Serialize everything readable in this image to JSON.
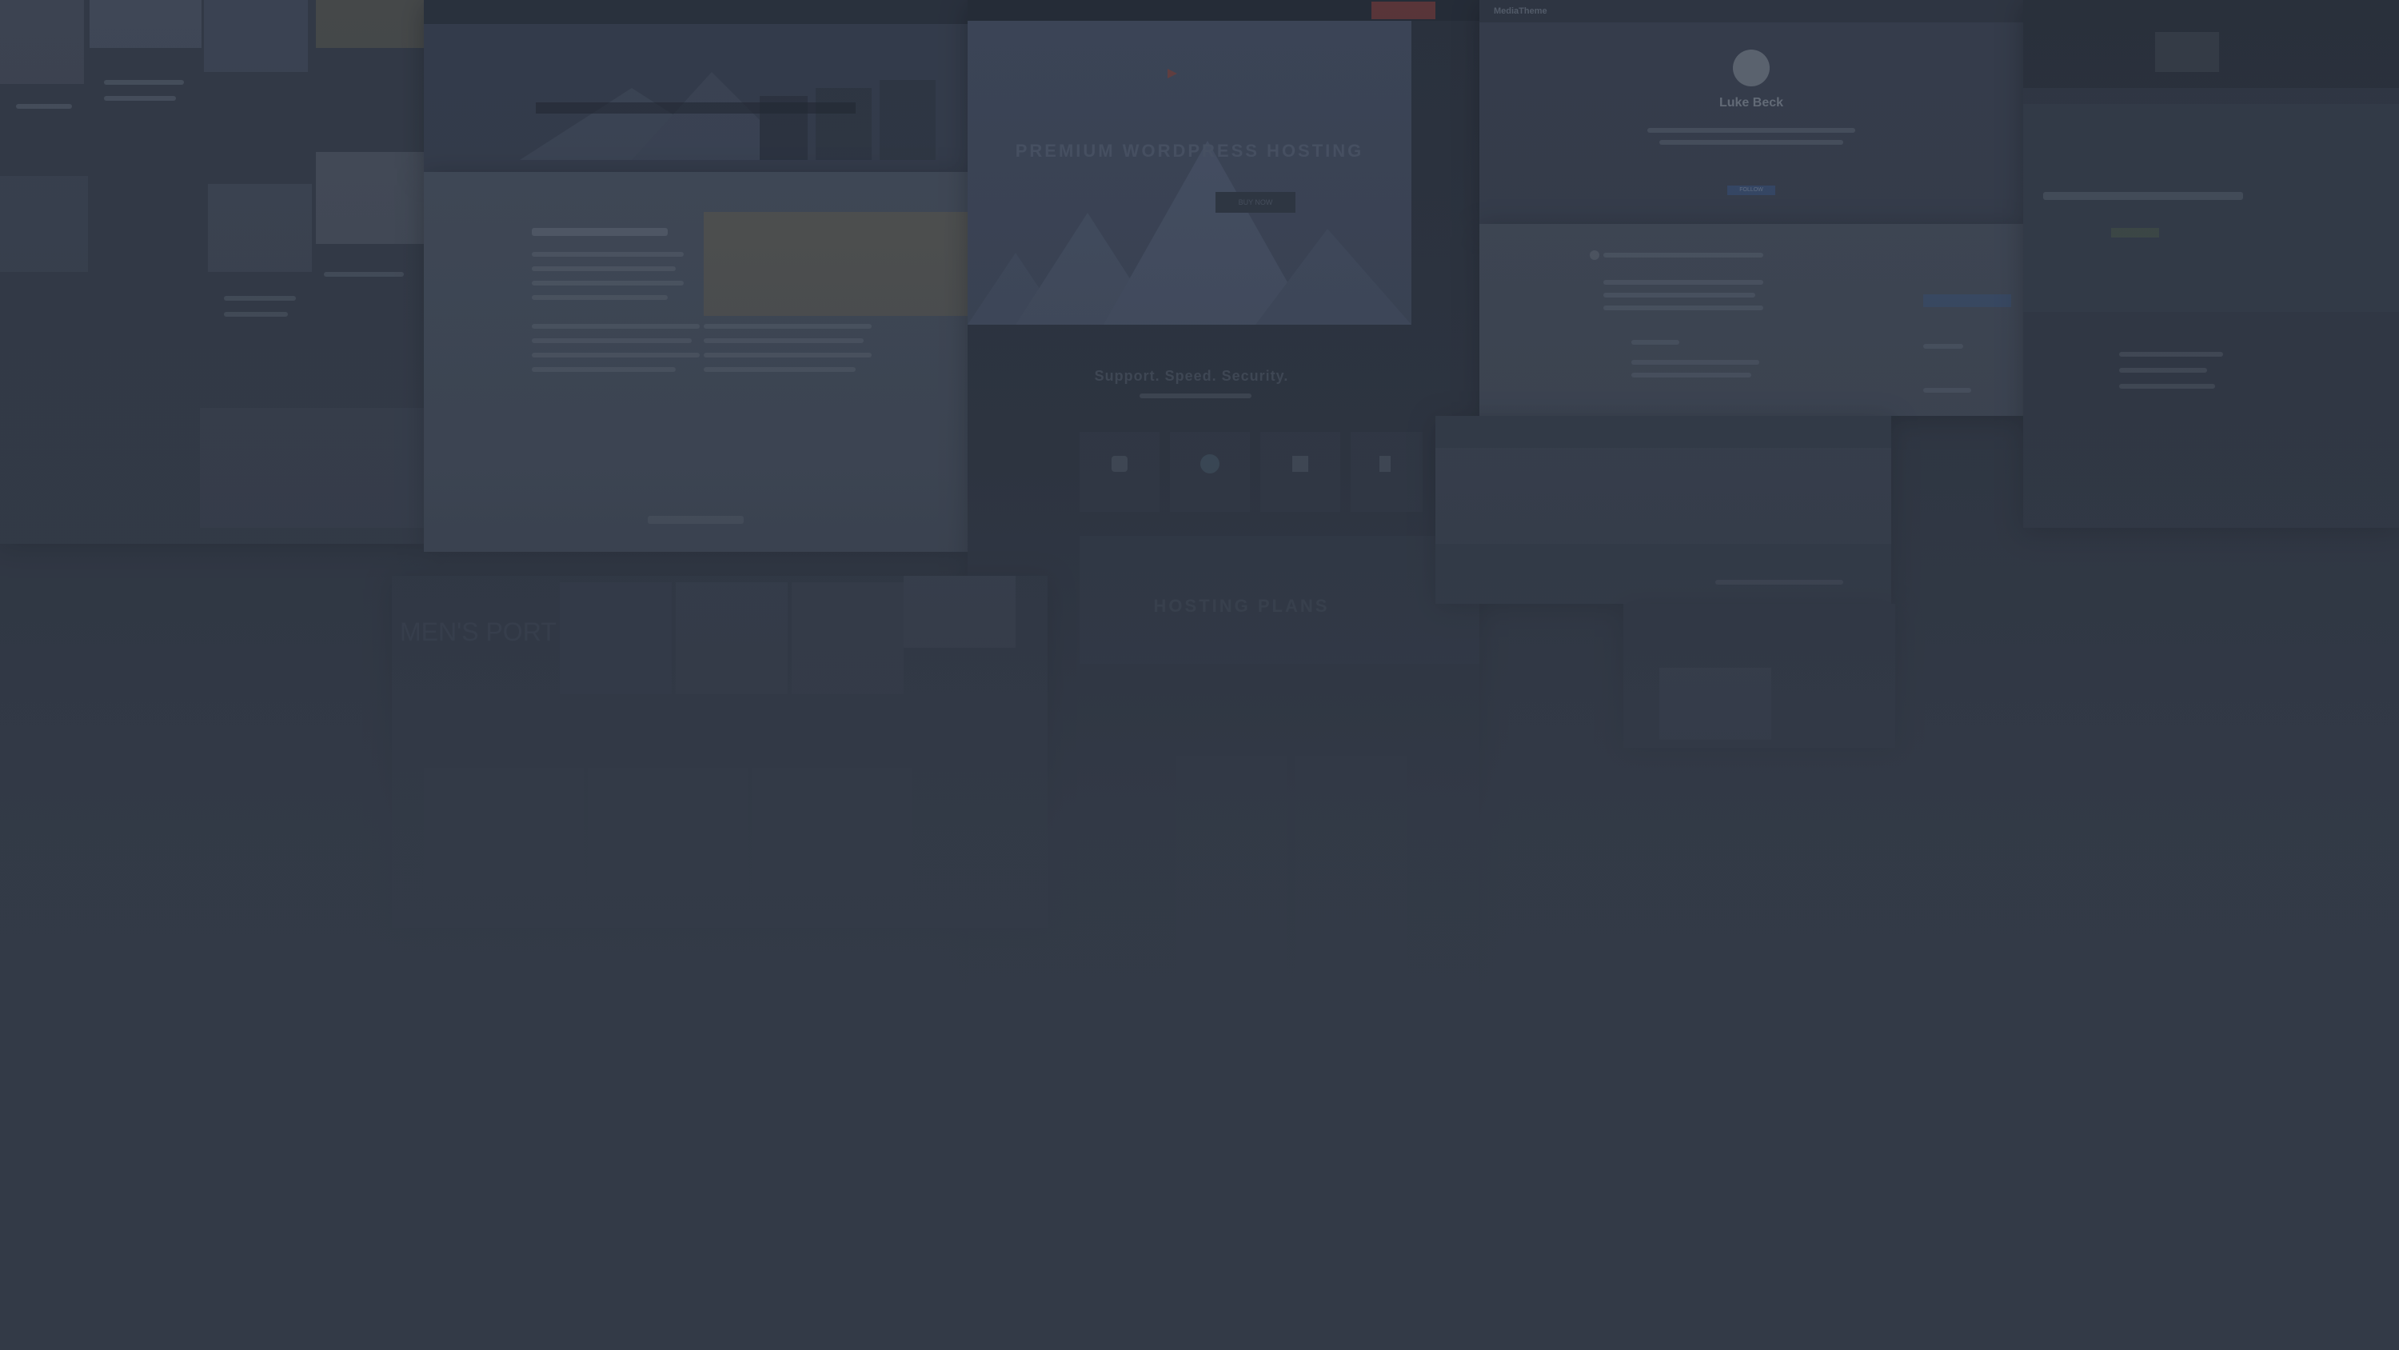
{
  "background_color": "#333a47",
  "hosting": {
    "hero_title": "PREMIUM WORDPRESS HOSTING",
    "hero_button": "BUY NOW",
    "features_title": "Support. Speed. Security.",
    "plans_title": "HOSTING PLANS",
    "accent": "#e24a3b"
  },
  "profile": {
    "brand": "MediaTheme",
    "name": "Luke Beck",
    "button": "FOLLOW"
  },
  "blog": {
    "heading": "MEN'S PORT"
  },
  "icons": [
    "lock-icon",
    "globe-icon",
    "thumbs-up-icon",
    "rocket-icon"
  ]
}
